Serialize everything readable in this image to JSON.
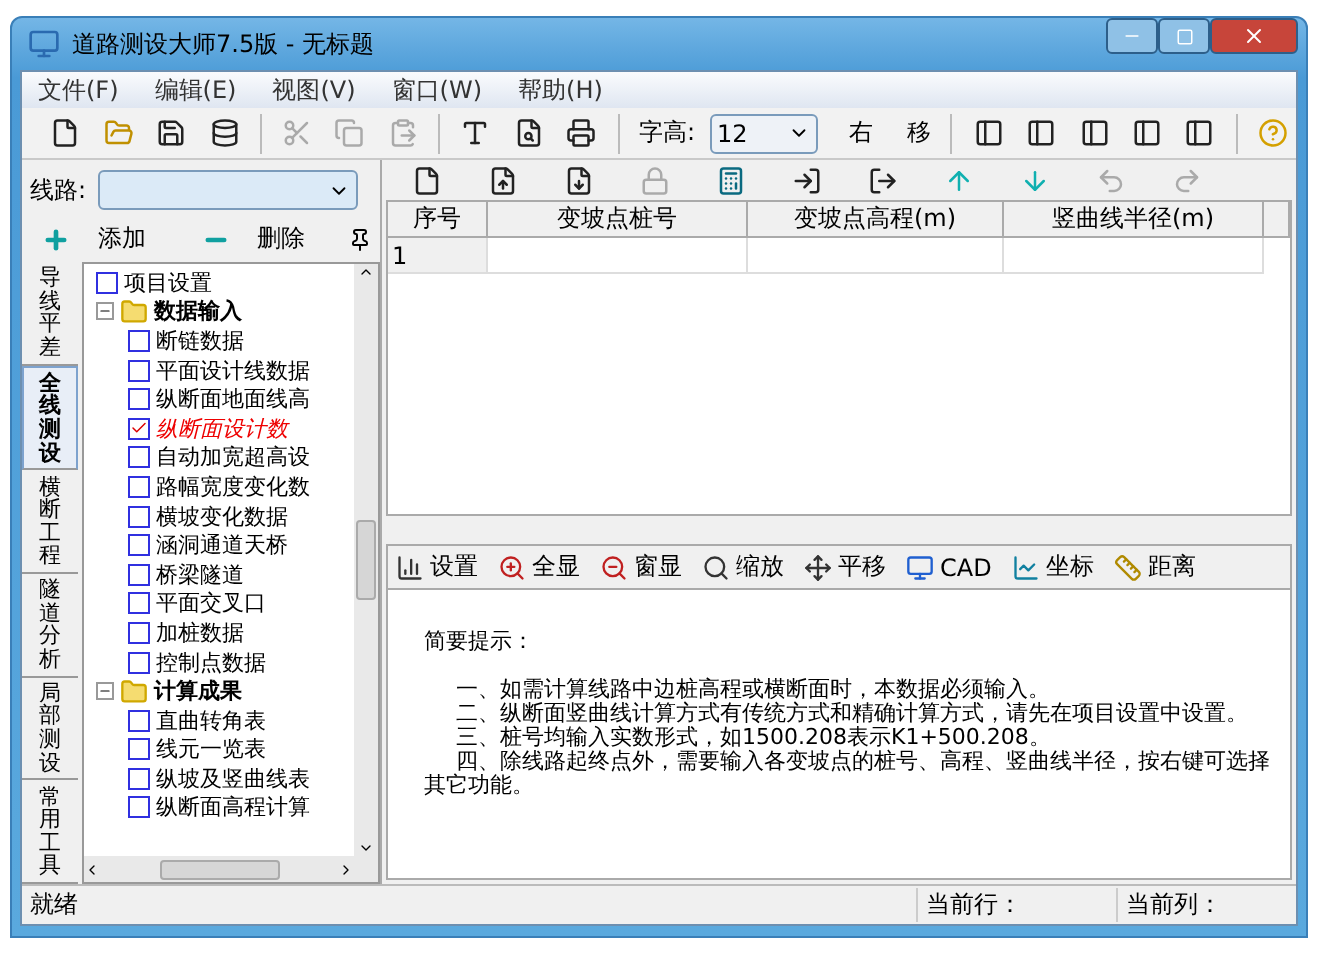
{
  "window": {
    "title": "道路测设大师7.5版 - 无标题"
  },
  "menu": [
    {
      "label": "文件(F)"
    },
    {
      "label": "编辑(E)"
    },
    {
      "label": "视图(V)"
    },
    {
      "label": "窗口(W)"
    },
    {
      "label": "帮助(H)"
    }
  ],
  "toolbar": {
    "icons_left": [
      {
        "kind": "new",
        "disabled": false
      },
      {
        "kind": "open",
        "disabled": false
      },
      {
        "kind": "save",
        "disabled": false
      },
      {
        "kind": "database",
        "disabled": false
      },
      {
        "kind": "cut",
        "disabled": true
      },
      {
        "kind": "copy",
        "disabled": true
      },
      {
        "kind": "paste",
        "disabled": true
      },
      {
        "kind": "text",
        "disabled": false
      },
      {
        "kind": "preview",
        "disabled": false
      },
      {
        "kind": "print",
        "disabled": false
      }
    ],
    "font_height_label": "字高:",
    "font_height_value": "12",
    "right_label": "右",
    "move_label": "移",
    "icons_right": [
      {
        "kind": "layout",
        "disabled": false
      },
      {
        "kind": "layout",
        "disabled": false
      },
      {
        "kind": "layout",
        "disabled": false
      },
      {
        "kind": "layout",
        "disabled": false
      },
      {
        "kind": "layout",
        "disabled": false
      },
      {
        "kind": "help",
        "disabled": false
      }
    ]
  },
  "left_panel": {
    "route_label": "线路:",
    "add_button": "添加",
    "delete_button": "删除",
    "vertical_tabs": [
      {
        "label": "导线平差",
        "selected": false
      },
      {
        "label": "全线测设",
        "selected": true
      },
      {
        "label": "横断工程",
        "selected": false
      },
      {
        "label": "隧道分析",
        "selected": false
      },
      {
        "label": "局部测设",
        "selected": false
      },
      {
        "label": "常用工具",
        "selected": false
      }
    ],
    "tree": [
      {
        "label": "项目设置",
        "kind": "item",
        "checked": false
      },
      {
        "label": "数据输入",
        "kind": "folder",
        "expanded": true,
        "children": [
          {
            "label": "断链数据",
            "kind": "item",
            "checked": false
          },
          {
            "label": "平面设计线数据",
            "kind": "item",
            "checked": false
          },
          {
            "label": "纵断面地面线高",
            "kind": "item",
            "checked": false
          },
          {
            "label": "纵断面设计数",
            "kind": "item",
            "checked": true
          },
          {
            "label": "自动加宽超高设",
            "kind": "item",
            "checked": false
          },
          {
            "label": "路幅宽度变化数",
            "kind": "item",
            "checked": false
          },
          {
            "label": "横坡变化数据",
            "kind": "item",
            "checked": false
          },
          {
            "label": "涵洞通道天桥",
            "kind": "item",
            "checked": false
          },
          {
            "label": "桥梁隧道",
            "kind": "item",
            "checked": false
          },
          {
            "label": "平面交叉口",
            "kind": "item",
            "checked": false
          },
          {
            "label": "加桩数据",
            "kind": "item",
            "checked": false
          },
          {
            "label": "控制点数据",
            "kind": "item",
            "checked": false
          }
        ]
      },
      {
        "label": "计算成果",
        "kind": "folder",
        "expanded": true,
        "children": [
          {
            "label": "直曲转角表",
            "kind": "item",
            "checked": false
          },
          {
            "label": "线元一览表",
            "kind": "item",
            "checked": false
          },
          {
            "label": "纵坡及竖曲线表",
            "kind": "item",
            "checked": false
          },
          {
            "label": "纵断面高程计算",
            "kind": "item",
            "checked": false
          }
        ]
      }
    ]
  },
  "grid_toolbar": [
    {
      "kind": "blank",
      "disabled": false
    },
    {
      "kind": "insert",
      "disabled": false
    },
    {
      "kind": "append",
      "disabled": false
    },
    {
      "kind": "lock",
      "disabled": true
    },
    {
      "kind": "calc",
      "disabled": false
    },
    {
      "kind": "import",
      "disabled": false
    },
    {
      "kind": "export",
      "disabled": false
    },
    {
      "kind": "up",
      "disabled": false
    },
    {
      "kind": "down",
      "disabled": false
    },
    {
      "kind": "undo",
      "disabled": true
    },
    {
      "kind": "redo",
      "disabled": true
    }
  ],
  "table": {
    "columns": [
      "序号",
      "变坡点桩号",
      "变坡点高程(m)",
      "竖曲线半径(m)"
    ],
    "rows": [
      {
        "cells": [
          "1"
        ]
      }
    ]
  },
  "view_toolbar": [
    {
      "kind": "settings",
      "label": "设置"
    },
    {
      "kind": "fit",
      "label": "全显"
    },
    {
      "kind": "window",
      "label": "窗显"
    },
    {
      "kind": "zoom",
      "label": "缩放"
    },
    {
      "kind": "pan",
      "label": "平移"
    },
    {
      "kind": "cad",
      "label": "CAD"
    },
    {
      "kind": "coords",
      "label": "坐标"
    },
    {
      "kind": "distance",
      "label": "距离"
    }
  ],
  "hints": {
    "title": "简要提示：",
    "lines": [
      "一、如需计算线路中边桩高程或横断面时，本数据必须输入。",
      "二、纵断面竖曲线计算方式有传统方式和精确计算方式，请先在项目设置中设置。",
      "三、桩号均输入实数形式，如1500.208表示K1+500.208。",
      "四、除线路起终点外，需要输入各变坡点的桩号、高程、竖曲线半径，按右键可选择其它功能。"
    ]
  },
  "status_bar": {
    "state": "就绪",
    "current_row": "当前行：",
    "current_col": "当前列："
  }
}
